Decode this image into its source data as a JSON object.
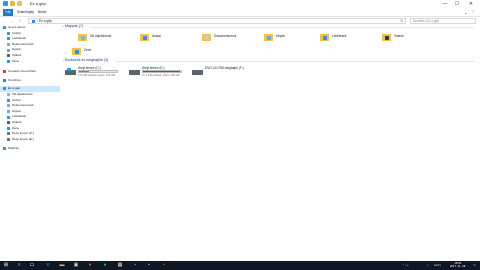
{
  "window": {
    "title": "Ez a gép",
    "minimize": "—",
    "maximize": "☐",
    "close": "✕",
    "help": "?"
  },
  "ribbon": {
    "tabs": [
      "Fájl",
      "Számítógép",
      "Nézet"
    ],
    "expand": "⌄"
  },
  "address": {
    "back": "←",
    "forward": "→",
    "up": "↑",
    "path": "Ez a gép",
    "refresh": "↻",
    "search_placeholder": "Keresés: Ez a gép"
  },
  "nav": {
    "items": [
      {
        "label": "Gyors elérés",
        "icon": "star-icon",
        "color": "#3d8de0",
        "indent": 0
      },
      {
        "label": "Asztal",
        "icon": "desktop-icon",
        "color": "#3d8de0",
        "indent": 1
      },
      {
        "label": "Letöltések",
        "icon": "download-icon",
        "color": "#3d8de0",
        "indent": 1
      },
      {
        "label": "Dokumentumok",
        "icon": "documents-icon",
        "color": "#9aa3ad",
        "indent": 1
      },
      {
        "label": "Képek",
        "icon": "pictures-icon",
        "color": "#6fa7d8",
        "indent": 1
      },
      {
        "label": "Videók",
        "icon": "videos-icon",
        "color": "#555b66",
        "indent": 1
      },
      {
        "label": "Zene",
        "icon": "music-icon",
        "color": "#3d8de0",
        "indent": 1
      },
      {
        "label": "Creative Cloud Files",
        "icon": "creative-cloud-icon",
        "color": "#d23a3a",
        "indent": 0
      },
      {
        "label": "OneDrive",
        "icon": "onedrive-icon",
        "color": "#2e7fd2",
        "indent": 0
      },
      {
        "label": "Ez a gép",
        "icon": "this-pc-icon",
        "color": "#3b8ad8",
        "indent": 0,
        "selected": true
      },
      {
        "label": "3D objektumok",
        "icon": "3d-objects-icon",
        "color": "#7ab6e8",
        "indent": 1
      },
      {
        "label": "Asztal",
        "icon": "desktop-icon",
        "color": "#3d8de0",
        "indent": 1
      },
      {
        "label": "Dokumentumok",
        "icon": "documents-icon",
        "color": "#9aa3ad",
        "indent": 1
      },
      {
        "label": "Képek",
        "icon": "pictures-icon",
        "color": "#6fa7d8",
        "indent": 1
      },
      {
        "label": "Letöltések",
        "icon": "download-icon",
        "color": "#3d8de0",
        "indent": 1
      },
      {
        "label": "Videók",
        "icon": "videos-icon",
        "color": "#555b66",
        "indent": 1
      },
      {
        "label": "Zene",
        "icon": "music-icon",
        "color": "#3d8de0",
        "indent": 1
      },
      {
        "label": "Helyi lemez (C:)",
        "icon": "drive-c-icon",
        "color": "#6d7480",
        "indent": 1
      },
      {
        "label": "Helyi lemez (E:)",
        "icon": "drive-e-icon",
        "color": "#6d7480",
        "indent": 1
      },
      {
        "label": "Hálózat",
        "icon": "network-icon",
        "color": "#3b8ad8",
        "indent": 0
      }
    ]
  },
  "groups": {
    "folders_header": "Mappák (7)",
    "drives_header": "Eszközök és meghajtók (3)"
  },
  "folders": [
    {
      "label": "3D objektumok",
      "icon": "3d-objects-folder-icon"
    },
    {
      "label": "Asztal",
      "icon": "desktop-folder-icon"
    },
    {
      "label": "Dokumentumok",
      "icon": "documents-folder-icon"
    },
    {
      "label": "Képek",
      "icon": "pictures-folder-icon"
    },
    {
      "label": "Letöltések",
      "icon": "downloads-folder-icon"
    },
    {
      "label": "Videók",
      "icon": "videos-folder-icon"
    },
    {
      "label": "Zene",
      "icon": "music-folder-icon"
    }
  ],
  "drives": [
    {
      "name": "Helyi lemez (C:)",
      "free": "173 GB szabad, teljes: 236 GB",
      "used_fraction": 0.27,
      "bar_color": "#26a0da",
      "icon": "windows-drive-icon",
      "has_bar": true
    },
    {
      "name": "Helyi lemez (E:)",
      "free": "11,7 GB szabad, teljes: 465 GB",
      "used_fraction": 0.97,
      "bar_color": "#da2626",
      "icon": "hard-drive-icon",
      "has_bar": true
    },
    {
      "name": "DVD-CD-RW-meghajtó (F:)",
      "free": "",
      "used_fraction": 0,
      "bar_color": "#26a0da",
      "icon": "dvd-drive-icon",
      "has_bar": false
    }
  ],
  "status": {
    "count": "10 elem"
  },
  "taskbar": {
    "clock_time": "18:51",
    "clock_date": "2017. 11. 28.",
    "lang": "HUN"
  }
}
